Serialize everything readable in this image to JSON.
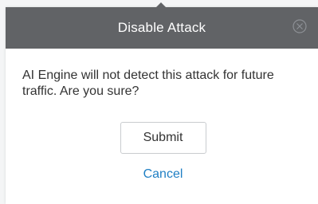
{
  "dialog": {
    "title": "Disable Attack",
    "close_icon": "circle-x-icon",
    "message": "AI Engine will not detect this attack for future traffic. Are you sure?",
    "submit_label": "Submit",
    "cancel_label": "Cancel"
  },
  "colors": {
    "header_bg": "#616366",
    "link": "#1f7fc4",
    "text": "#333333"
  }
}
